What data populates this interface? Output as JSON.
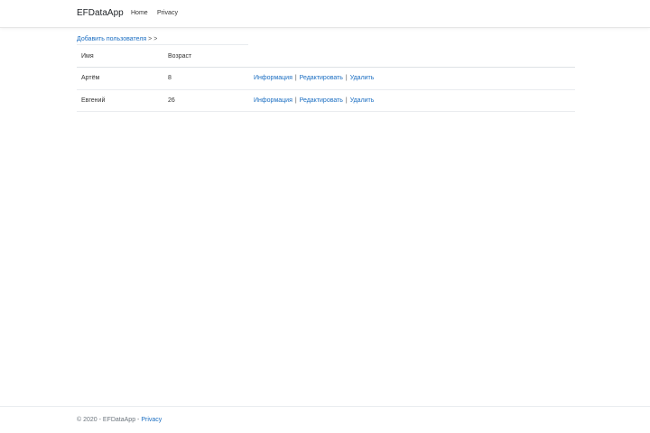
{
  "navbar": {
    "brand": "EFDataApp",
    "links": [
      "Home",
      "Privacy"
    ]
  },
  "breadcrumb": {
    "add_user": "Добавить пользователя",
    "separator": "> >"
  },
  "table": {
    "headers": [
      "Имя",
      "Возраст",
      ""
    ],
    "rows": [
      {
        "name": "Артём",
        "age": "8",
        "info": "Информация",
        "edit": "Редактировать",
        "delete": "Удалить"
      },
      {
        "name": "Евгений",
        "age": "26",
        "info": "Информация",
        "edit": "Редактировать",
        "delete": "Удалить"
      }
    ],
    "pipe": "|"
  },
  "footer": {
    "copyright": "© 2020 - EFDataApp - ",
    "privacy": "Privacy"
  },
  "colors": {
    "link": "#1b6ec2",
    "text": "#212529",
    "muted": "#6c757d"
  }
}
